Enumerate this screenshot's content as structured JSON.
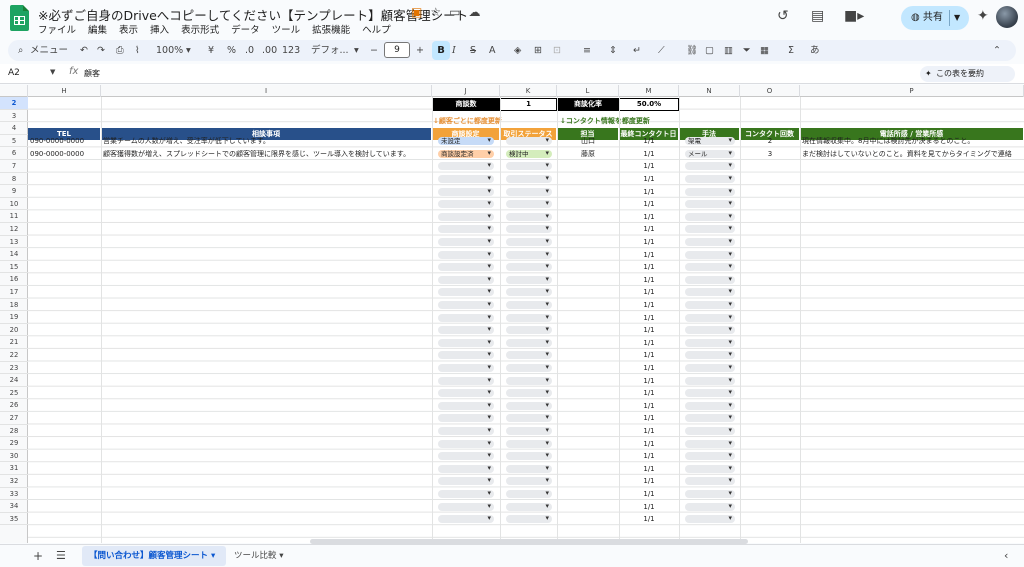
{
  "doc": {
    "title": "※必ずご自身のDriveへコピーしてください【テンプレート】顧客管理シート"
  },
  "header": {
    "share_label": "共有"
  },
  "menus": [
    "ファイル",
    "編集",
    "表示",
    "挿入",
    "表示形式",
    "データ",
    "ツール",
    "拡張機能",
    "ヘルプ"
  ],
  "toolbar": {
    "menu_search": "メニュー",
    "zoom": "100%",
    "currency": "¥",
    "percent": "%",
    "dec_dec": ".0",
    "dec_inc": ".00",
    "num_fmt": "123",
    "font": "デフォ...",
    "font_size": "9",
    "input_tools": "あ"
  },
  "formula": {
    "cell_ref": "A2",
    "content": "顧客"
  },
  "summary_button": "この表を要約",
  "columns": [
    "H",
    "I",
    "J",
    "K",
    "L",
    "M",
    "N",
    "O",
    "P"
  ],
  "rows": [
    "2",
    "3",
    "4",
    "5",
    "6",
    "7",
    "8",
    "9",
    "10",
    "11",
    "12",
    "13",
    "14",
    "15",
    "16",
    "17",
    "18",
    "19",
    "20",
    "21",
    "22",
    "23",
    "24",
    "25",
    "26",
    "27",
    "28",
    "29",
    "30",
    "31",
    "32",
    "33",
    "34",
    "35"
  ],
  "kpi": {
    "deals_label": "商談数",
    "deals_value": "1",
    "rate_label": "商談化率",
    "rate_value": "50.0%"
  },
  "notes": {
    "deal": "↓顧客ごとに都度更新",
    "contact": "↓コンタクト情報を都度更新"
  },
  "headers": {
    "tel": "TEL",
    "consult": "相談事項",
    "deal_setting": "商談設定",
    "status": "取引ステータス",
    "owner": "担当",
    "last_contact": "最終コンタクト日",
    "method": "手法",
    "contact_count": "コンタクト回数",
    "call_note": "電話所感 / 営業所感"
  },
  "data_rows": [
    {
      "tel": "090-0000-0000",
      "consult": "営業チームの人数が増え、受注率が低下しています。",
      "deal_setting": "未設定",
      "status": "",
      "owner": "山口",
      "last_contact": "1/1",
      "method": "架電",
      "contact_count": "2",
      "call_note": "現在情報収集中。8月中には検討先が決まるとのこと。"
    },
    {
      "tel": "090-0000-0000",
      "consult": "顧客獲得数が増え、スプレッドシートでの顧客管理に限界を感じ、ツール導入を検討しています。",
      "deal_setting": "商談設定済",
      "status": "検討中",
      "owner": "藤原",
      "last_contact": "1/1",
      "method": "メール",
      "contact_count": "3",
      "call_note": "まだ検討はしていないとのこと。資料を見てからタイミングで連絡"
    }
  ],
  "empty_last_contact": "1/1",
  "colors": {
    "blue_header": "#28508a",
    "orange_header": "#f2a23a",
    "green_header": "#38761d",
    "chip_blue": "#c6dbf7",
    "chip_orange": "#ffcfa8",
    "chip_green": "#d4edbc"
  },
  "sheet_tabs": {
    "active": "【問い合わせ】顧客管理シート",
    "other": "ツール比較"
  }
}
